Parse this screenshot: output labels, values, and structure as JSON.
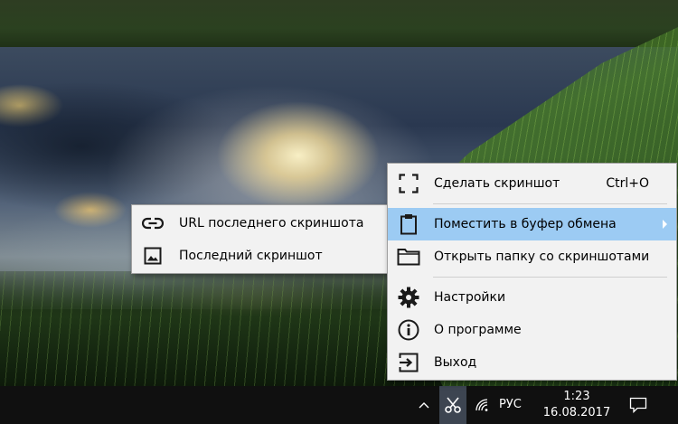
{
  "main_menu": {
    "items": [
      {
        "label": "Сделать скриншот",
        "shortcut": "Ctrl+O",
        "icon": "screenshot-frame-icon"
      },
      {
        "label": "Поместить в буфер обмена",
        "icon": "clipboard-icon",
        "has_submenu": true,
        "highlighted": true
      },
      {
        "label": "Открыть папку со скриншотами",
        "icon": "folder-icon"
      },
      {
        "label": "Настройки",
        "icon": "gear-icon"
      },
      {
        "label": "О программе",
        "icon": "info-icon"
      },
      {
        "label": "Выход",
        "icon": "exit-icon"
      }
    ]
  },
  "sub_menu": {
    "items": [
      {
        "label": "URL последнего скриншота",
        "icon": "link-icon"
      },
      {
        "label": "Последний скриншот",
        "icon": "image-icon"
      }
    ]
  },
  "taskbar": {
    "language": "РУС",
    "time": "1:23",
    "date": "16.08.2017"
  },
  "colors": {
    "menu_background": "#f2f2f2",
    "menu_highlight": "#9ccbf3",
    "taskbar_background": "#101010",
    "tray_app_active": "#3d4551"
  }
}
